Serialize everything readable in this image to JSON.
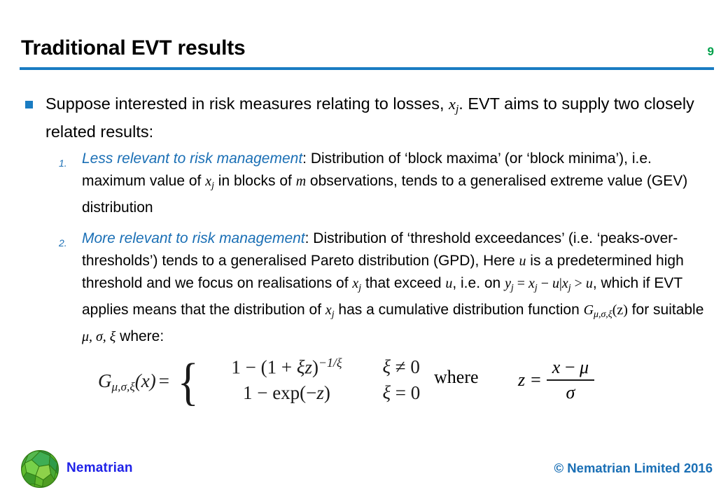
{
  "slide": {
    "title": "Traditional EVT results",
    "page_number": "9",
    "accent_blue": "#1a7cc2",
    "heading_blue": "#1a6fb5",
    "page_number_green": "#00a14b",
    "logo_blue": "#1f22e8"
  },
  "bullet1": {
    "text_part1": "Suppose interested in risk measures relating to losses, ",
    "math_x": "x",
    "math_x_sub": "j",
    "text_part2": ". EVT aims to supply two closely related results:"
  },
  "numbered_items": [
    {
      "marker": "1.",
      "highlight": "Less relevant to risk management",
      "t1": ": Distribution of ‘block maxima’ (or ‘block minima’), i.e. maximum value of ",
      "m1": "x",
      "m1sub": "j",
      "t2": " in blocks of ",
      "m2": "m",
      "t3": " observations, tends to a generalised extreme value (GEV) distribution"
    },
    {
      "marker": "2.",
      "highlight": "More relevant to risk management",
      "t1": ": Distribution of ‘threshold exceedances’ (i.e. ‘peaks-over-thresholds’) tends to a generalised Pareto distribution (GPD), Here ",
      "m1": "u",
      "t2": " is a predetermined high threshold and we focus on realisations of ",
      "m2": "x",
      "m2sub": "j",
      "t3": " that exceed ",
      "m3": "u",
      "t4": ", i.e. on ",
      "m4_y": "y",
      "m4_ysub": "j",
      "m4_eq": " = ",
      "m4_x1": "x",
      "m4_x1sub": "j",
      "m4_minus": " − ",
      "m4_u": "u",
      "m4_bar": "|",
      "m4_x2": "x",
      "m4_x2sub": "j",
      "m4_gt": " > ",
      "m4_u2": "u",
      "t5": ", which if EVT applies means that the distribution of ",
      "m5": "x",
      "m5sub": "j",
      "t6": " has a cumulative distribution function ",
      "m6_G": "G",
      "m6_Gsub": "μ,σ,ξ",
      "m6_arg": "(z)",
      "t7": " for suitable ",
      "m7": "μ, σ, ξ",
      "t8": " where:"
    }
  ],
  "equation": {
    "lhs_G": "G",
    "lhs_sub": "μ,σ,ξ",
    "lhs_arg": "(x)",
    "equals": "=",
    "case1_expr_a": "1 − (1 + ",
    "case1_xi": "ξ",
    "case1_z": "z",
    "case1_expr_b": ")",
    "case1_exponent": "−1/ξ",
    "case1_cond_xi": "ξ",
    "case1_cond_rel": " ≠ 0",
    "case2_expr_a": "1 − exp(−",
    "case2_z": "z",
    "case2_expr_b": ")",
    "case2_cond_xi": "ξ",
    "case2_cond_rel": " = 0",
    "where_label": "where",
    "frac_var": "z",
    "frac_equals": "=",
    "frac_numerator_x": "x",
    "frac_numerator_op": " − ",
    "frac_numerator_mu": "μ",
    "frac_denominator": "σ"
  },
  "footer": {
    "logo_label": "Nematrian",
    "copyright": "© Nematrian Limited 2016"
  }
}
